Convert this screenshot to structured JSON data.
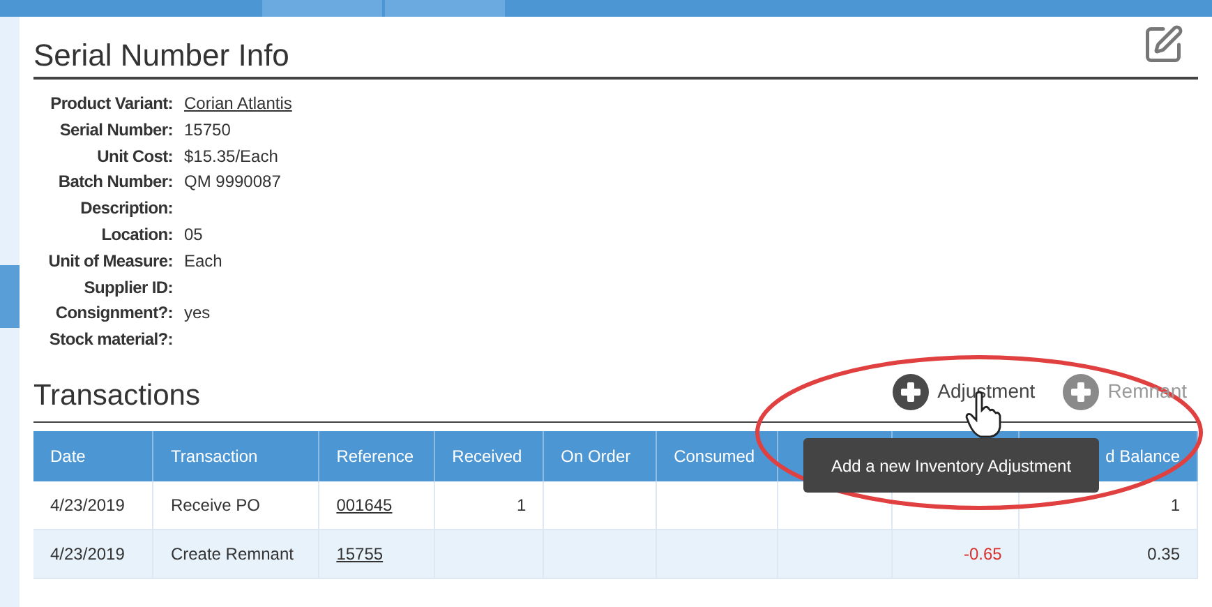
{
  "info": {
    "title": "Serial Number Info",
    "fields": [
      {
        "label": "Product Variant:",
        "value": "Corian Atlantis",
        "kind": "link"
      },
      {
        "label": "Serial Number:",
        "value": "15750",
        "kind": "text"
      },
      {
        "label": "Unit Cost:",
        "value": "$15.35/Each",
        "kind": "text"
      },
      {
        "label": "Batch Number:",
        "value": "QM 9990087",
        "kind": "text"
      },
      {
        "label": "Description:",
        "kind": "text"
      },
      {
        "label": "Location:",
        "value": "05",
        "kind": "text"
      },
      {
        "label": "Unit of Measure:",
        "value": "Each",
        "kind": "text"
      },
      {
        "label": "Supplier ID:",
        "kind": "text"
      },
      {
        "label": "Consignment?:",
        "value": "yes",
        "kind": "text"
      },
      {
        "label": "Stock material?:",
        "kind": "text"
      }
    ]
  },
  "transactions": {
    "title": "Transactions",
    "actions": [
      {
        "label": "Adjustment",
        "disabled": false
      },
      {
        "label": "Remnant",
        "disabled": true
      }
    ],
    "table": {
      "columns": [
        "Date",
        "Transaction",
        "Reference",
        "Received",
        "On Order",
        "Consumed",
        "",
        "",
        "d Balance"
      ],
      "rows": [
        {
          "cells": [
            {
              "text": "4/23/2019"
            },
            {
              "text": "Receive PO"
            },
            {
              "text": "001645",
              "kind": "link"
            },
            {
              "text": "1"
            },
            {
              "text": ""
            },
            {
              "text": ""
            },
            {
              "text": ""
            },
            {
              "text": ""
            },
            {
              "text": "1"
            }
          ]
        },
        {
          "cells": [
            {
              "text": "4/23/2019"
            },
            {
              "text": "Create Remnant"
            },
            {
              "text": "15755",
              "kind": "link"
            },
            {
              "text": ""
            },
            {
              "text": ""
            },
            {
              "text": ""
            },
            {
              "text": ""
            },
            {
              "text": "-0.65",
              "color": "#d9302c"
            },
            {
              "text": "0.35"
            }
          ]
        }
      ]
    },
    "tooltip": "Add a new Inventory Adjustment"
  }
}
